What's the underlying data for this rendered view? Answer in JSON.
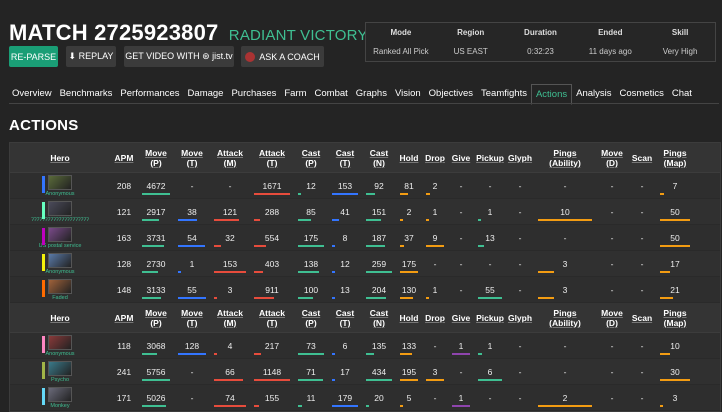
{
  "header": {
    "match_title": "MATCH 2725923807",
    "result": "RADIANT VICTORY"
  },
  "buttons": {
    "reparse": "RE-PARSE",
    "replay": "⬇ REPLAY",
    "get_video": "GET VIDEO WITH ⊛ jist.tv",
    "ask_coach": "ASK A COACH"
  },
  "summary": {
    "headers": [
      "Mode",
      "Region",
      "Duration",
      "Ended",
      "Skill"
    ],
    "values": [
      "Ranked All Pick",
      "US EAST",
      "0:32:23",
      "11 days ago",
      "Very High"
    ]
  },
  "tabs": [
    "Overview",
    "Benchmarks",
    "Performances",
    "Damage",
    "Purchases",
    "Farm",
    "Combat",
    "Graphs",
    "Vision",
    "Objectives",
    "Teamfights",
    "Actions",
    "Analysis",
    "Cosmetics",
    "Chat"
  ],
  "active_tab": "Actions",
  "section_title": "ACTIONS",
  "columns": [
    "Hero",
    "APM",
    "Move\n(P)",
    "Move\n(T)",
    "Attack\n(M)",
    "Attack\n(T)",
    "Cast\n(P)",
    "Cast\n(T)",
    "Cast\n(N)",
    "Hold",
    "Drop",
    "Give",
    "Pickup",
    "Glyph",
    "Pings\n(Ability)",
    "Move\n(D)",
    "Scan",
    "Pings\n(Map)"
  ],
  "teams": [
    {
      "rows": [
        {
          "player": "Anonymous",
          "player_color": "#3375ff",
          "hero_color": "#5a6b3a",
          "cells": [
            "208",
            "4672",
            "-",
            "-",
            "1671",
            "12",
            "153",
            "92",
            "81",
            "2",
            "-",
            "-",
            "-",
            "-",
            "-",
            "-",
            "7"
          ]
        },
        {
          "player": "ʔʔʔʔʔʔʔʔʔʔʔʔʔʔʔʔʔʔʔʔʔ",
          "player_color": "#66ffbf",
          "hero_color": "#4a4a5a",
          "cells": [
            "121",
            "2917",
            "38",
            "121",
            "288",
            "85",
            "41",
            "151",
            "2",
            "1",
            "-",
            "1",
            "-",
            "10",
            "-",
            "-",
            "50"
          ]
        },
        {
          "player": "US postal service",
          "player_color": "#bf00bf",
          "hero_color": "#7a4a8a",
          "cells": [
            "163",
            "3731",
            "54",
            "32",
            "554",
            "175",
            "8",
            "187",
            "37",
            "9",
            "-",
            "13",
            "-",
            "-",
            "-",
            "-",
            "50"
          ]
        },
        {
          "player": "Anonymous",
          "player_color": "#f3f00b",
          "hero_color": "#5a7aa8",
          "cells": [
            "128",
            "2730",
            "1",
            "153",
            "403",
            "138",
            "12",
            "259",
            "175",
            "-",
            "-",
            "-",
            "-",
            "3",
            "-",
            "-",
            "17"
          ]
        },
        {
          "player": "Faded",
          "player_color": "#ff6b00",
          "hero_color": "#a0623a",
          "cells": [
            "148",
            "3133",
            "55",
            "3",
            "911",
            "100",
            "13",
            "204",
            "130",
            "1",
            "-",
            "55",
            "-",
            "3",
            "-",
            "-",
            "21"
          ]
        }
      ]
    },
    {
      "rows": [
        {
          "player": "Anonymous",
          "player_color": "#fe86c2",
          "hero_color": "#8a3a3a",
          "cells": [
            "118",
            "3068",
            "128",
            "4",
            "217",
            "73",
            "6",
            "135",
            "133",
            "-",
            "1",
            "1",
            "-",
            "-",
            "-",
            "-",
            "10"
          ]
        },
        {
          "player": "Psycho",
          "player_color": "#a1b447",
          "hero_color": "#3a7a8a",
          "cells": [
            "241",
            "5756",
            "-",
            "66",
            "1148",
            "71",
            "17",
            "434",
            "195",
            "3",
            "-",
            "6",
            "-",
            "-",
            "-",
            "-",
            "30"
          ]
        },
        {
          "player": "Monkey",
          "player_color": "#65d9f7",
          "hero_color": "#6a6a7a",
          "cells": [
            "171",
            "5026",
            "-",
            "74",
            "155",
            "11",
            "179",
            "20",
            "5",
            "-",
            "1",
            "-",
            "-",
            "2",
            "-",
            "-",
            "3"
          ]
        }
      ]
    }
  ],
  "colors": {
    "accent": "#3fbf92",
    "background": "#242424"
  }
}
